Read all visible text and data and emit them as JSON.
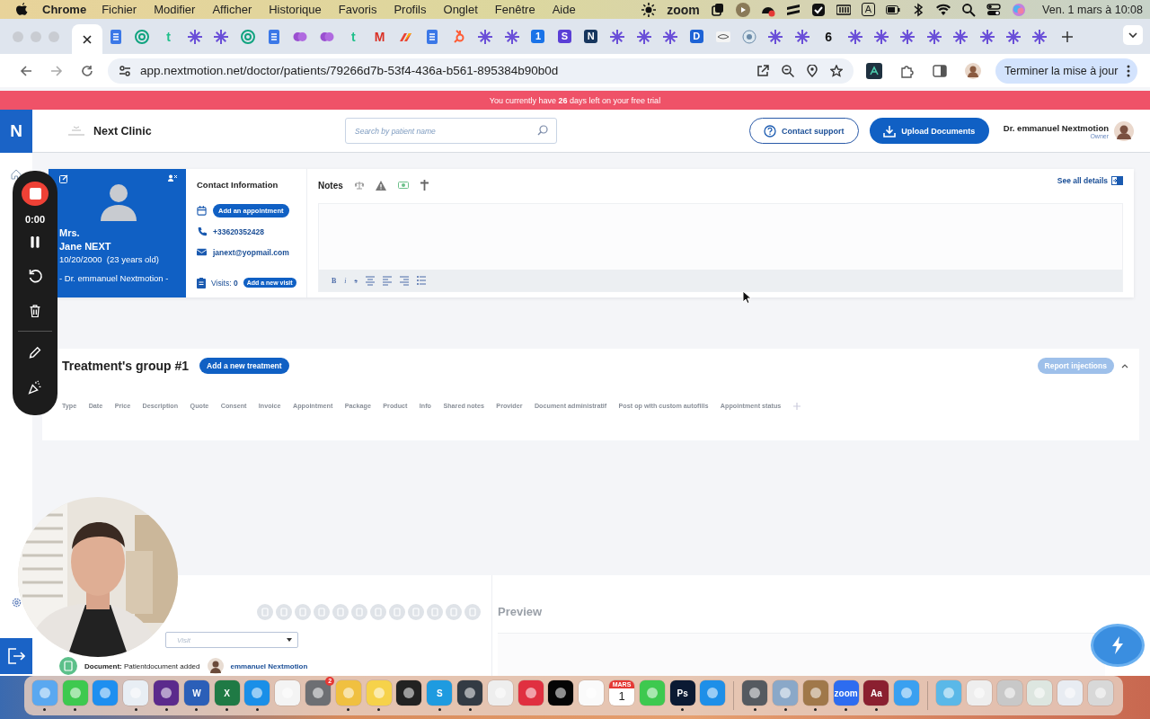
{
  "menubar": {
    "app_name": "Chrome",
    "menus": [
      "Fichier",
      "Modifier",
      "Afficher",
      "Historique",
      "Favoris",
      "Profils",
      "Onglet",
      "Fenêtre",
      "Aide"
    ],
    "status_items": [
      {
        "kind": "sun"
      },
      {
        "kind": "text",
        "text": "zoom"
      },
      {
        "kind": "copy"
      },
      {
        "kind": "disc"
      },
      {
        "kind": "gauge"
      },
      {
        "kind": "bars"
      },
      {
        "kind": "check"
      },
      {
        "kind": "memory"
      },
      {
        "kind": "boxed",
        "text": "A"
      },
      {
        "kind": "battery"
      },
      {
        "kind": "bluetooth"
      },
      {
        "kind": "wifi"
      },
      {
        "kind": "search"
      },
      {
        "kind": "switches"
      },
      {
        "kind": "siri"
      }
    ],
    "clock": "Ven. 1 mars à 10:08"
  },
  "browser": {
    "tabs": [
      {
        "selected": true
      },
      {
        "kind": "doc",
        "selected": false
      },
      {
        "kind": "knot",
        "selected": false
      },
      {
        "kind": "letter",
        "text": "t",
        "color": "#1fbf8a",
        "selected": false
      },
      {
        "kind": "flower",
        "selected": false
      },
      {
        "kind": "flower",
        "selected": false
      },
      {
        "kind": "knot",
        "selected": false
      },
      {
        "kind": "doc",
        "selected": false
      },
      {
        "kind": "brain",
        "selected": false
      },
      {
        "kind": "brain",
        "selected": false
      },
      {
        "kind": "letter",
        "text": "t",
        "color": "#1fbf8a",
        "selected": false
      },
      {
        "kind": "letter",
        "text": "M",
        "color": "#d93025",
        "selected": false
      },
      {
        "kind": "stripes",
        "selected": false
      },
      {
        "kind": "doc",
        "selected": false
      },
      {
        "kind": "sprocket",
        "selected": false
      },
      {
        "kind": "flower",
        "selected": false
      },
      {
        "kind": "flower",
        "selected": false
      },
      {
        "kind": "square-letter",
        "text": "1",
        "color": "#1a73e8",
        "selected": false
      },
      {
        "kind": "square-letter",
        "text": "S",
        "color": "#5b3fd6",
        "selected": false
      },
      {
        "kind": "square-letter",
        "text": "N",
        "color": "#17365e",
        "selected": false
      },
      {
        "kind": "flower",
        "selected": false
      },
      {
        "kind": "flower",
        "selected": false
      },
      {
        "kind": "flower",
        "selected": false
      },
      {
        "kind": "square-letter",
        "text": "D",
        "color": "#1e63d6",
        "selected": false
      },
      {
        "kind": "eye",
        "selected": false
      },
      {
        "kind": "globe",
        "selected": false
      },
      {
        "kind": "flower",
        "selected": false
      },
      {
        "kind": "flower",
        "selected": false
      },
      {
        "kind": "letter",
        "text": "6",
        "color": "#111111",
        "selected": false
      },
      {
        "kind": "flower",
        "selected": false
      },
      {
        "kind": "flower",
        "selected": false
      },
      {
        "kind": "flower",
        "selected": false
      },
      {
        "kind": "flower",
        "selected": false
      },
      {
        "kind": "flower",
        "selected": false
      },
      {
        "kind": "flower",
        "selected": false
      },
      {
        "kind": "flower",
        "selected": false
      },
      {
        "kind": "flower",
        "selected": false
      }
    ],
    "url": "app.nextmotion.net/doctor/patients/79266d7b-53f4-436a-b561-895384b90b0d",
    "update_button": "Terminer la mise à jour"
  },
  "trial_banner": "You currently have **26** days left on your free trial",
  "sidebar": {
    "logo": "N"
  },
  "header": {
    "clinic_name": "Next Clinic",
    "search": {
      "placeholder": "Search by patient name"
    },
    "contact_button": "Contact support",
    "upload_button": "Upload Documents",
    "user_name": "Dr. emmanuel Nextmotion",
    "user_role": "Owner"
  },
  "patient": {
    "title": "Mrs.",
    "name": "Jane NEXT",
    "birth": "10/20/2000  (23 years old)",
    "doctor": "- Dr. emmanuel Nextmotion -"
  },
  "contact": {
    "title": "Contact Information",
    "appointment_button": "Add an appointment",
    "phone": "+33620352428",
    "email": "janext@yopmail.com",
    "visits": "Visits: **0**",
    "visit_button": "Add a new visit"
  },
  "notes": {
    "title": "Notes",
    "see_all": "See all details",
    "format_buttons": [
      {
        "kind": "bold",
        "text": "B"
      },
      {
        "kind": "italic",
        "text": "i"
      },
      {
        "kind": "strike",
        "text": "s"
      },
      {
        "kind": "center"
      },
      {
        "kind": "left"
      },
      {
        "kind": "right"
      },
      {
        "kind": "list"
      }
    ]
  },
  "treatment_group": {
    "title": "Treatment's group #1",
    "add_button": "Add a new treatment",
    "report_button": "Report injections",
    "columns": [
      "Type",
      "Date",
      "Price",
      "Description",
      "Quote",
      "Consent",
      "Invoice",
      "Appointment",
      "Package",
      "Product",
      "Info",
      "Shared notes",
      "Provider",
      "Document administratif",
      "Post op with custom autofills",
      "Appointment status"
    ]
  },
  "documents": {
    "visit_select": {
      "placeholder": "Visit"
    },
    "preview_title": "Preview",
    "timeline": [
      {
        "text": "**Document:** Patientdocument added",
        "author": "emmanuel Nextmotion"
      }
    ]
  },
  "recorder": {
    "timer": "0:00"
  },
  "dock": [
    {
      "kind": "app",
      "color": "#5aa8f0",
      "running": true
    },
    {
      "kind": "app",
      "color": "#3ec94f",
      "running": true
    },
    {
      "kind": "app",
      "color": "#1e8ff0",
      "running": false
    },
    {
      "kind": "app",
      "color": "#e8eef4",
      "running": true
    },
    {
      "kind": "app",
      "color": "#5b2a8c",
      "running": true
    },
    {
      "kind": "app",
      "color": "#2b5fb8",
      "glyph": "W",
      "running": true
    },
    {
      "kind": "app",
      "color": "#1f7a45",
      "glyph": "X",
      "running": true
    },
    {
      "kind": "app",
      "color": "#1a8fe8",
      "running": true
    },
    {
      "kind": "app",
      "color": "#f4f4f4",
      "running": false
    },
    {
      "kind": "app",
      "color": "#6d6f73",
      "badge": "2",
      "running": false
    },
    {
      "kind": "app",
      "color": "#f0c040",
      "running": true
    },
    {
      "kind": "app",
      "color": "#f6d24a",
      "running": true
    },
    {
      "kind": "app",
      "color": "#222222",
      "running": false
    },
    {
      "kind": "app",
      "color": "#1e9be0",
      "glyph": "S",
      "running": true
    },
    {
      "kind": "app",
      "color": "#333b44",
      "running": true
    },
    {
      "kind": "app",
      "color": "#eeeeee",
      "running": false
    },
    {
      "kind": "app",
      "color": "#e03040",
      "running": false
    },
    {
      "kind": "app",
      "color": "#050505",
      "running": false
    },
    {
      "kind": "app",
      "color": "#fafafa",
      "running": false
    },
    {
      "kind": "calendar",
      "month": "MARS",
      "day": "1",
      "running": false
    },
    {
      "kind": "app",
      "color": "#3ec94f",
      "running": false
    },
    {
      "kind": "app",
      "color": "#0b1a33",
      "glyph": "Ps",
      "running": true
    },
    {
      "kind": "app",
      "color": "#1e8fe8",
      "running": false
    },
    {
      "kind": "separator"
    },
    {
      "kind": "app",
      "color": "#555a60",
      "running": true
    },
    {
      "kind": "app",
      "color": "#8aa8c8",
      "running": true
    },
    {
      "kind": "app",
      "color": "#a0784a",
      "running": true
    },
    {
      "kind": "app",
      "color": "#2d6cf0",
      "glyph": "zoom",
      "running": true
    },
    {
      "kind": "app",
      "color": "#8b2030",
      "glyph": "Aa",
      "running": true
    },
    {
      "kind": "app",
      "color": "#3aa0f0",
      "running": false
    },
    {
      "kind": "separator"
    },
    {
      "kind": "app",
      "color": "#5ab8e8",
      "running": false
    },
    {
      "kind": "app",
      "color": "#eeeeee",
      "running": false
    },
    {
      "kind": "app",
      "color": "#c8c8c8",
      "running": false
    },
    {
      "kind": "app",
      "color": "#dde6e0",
      "running": false
    },
    {
      "kind": "app",
      "color": "#e8ecf2",
      "running": false
    },
    {
      "kind": "app",
      "color": "#d8d8d8",
      "running": false
    }
  ]
}
